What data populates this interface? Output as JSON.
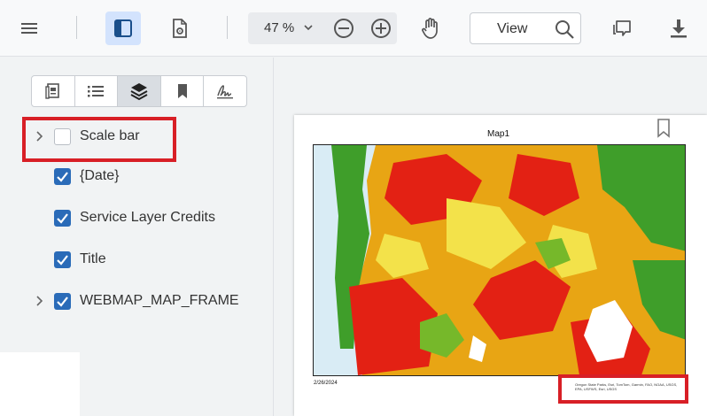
{
  "toolbar": {
    "zoom_value": "47 %",
    "view_label": "View"
  },
  "sidebar": {
    "tabs": [
      {
        "name": "thumbnails"
      },
      {
        "name": "outline"
      },
      {
        "name": "layers",
        "active": true
      },
      {
        "name": "bookmarks"
      },
      {
        "name": "signatures"
      }
    ],
    "layers": [
      {
        "label": "Scale bar",
        "checked": false,
        "expandable": true
      },
      {
        "label": "{Date}",
        "checked": true,
        "expandable": false
      },
      {
        "label": "Service Layer Credits",
        "checked": true,
        "expandable": false
      },
      {
        "label": "Title",
        "checked": true,
        "expandable": false
      },
      {
        "label": "WEBMAP_MAP_FRAME",
        "checked": true,
        "expandable": true
      }
    ]
  },
  "document": {
    "map_title": "Map1",
    "date": "2/26/2024",
    "credits": "Oregon State Parks, Esri, TomTom, Garmin, FAO, NOAA, USGS, EPA, USFWS, Esri, USGS"
  },
  "colors": {
    "accent": "#2a6bb8",
    "highlight": "#d81f26",
    "active_toggle": "#d3e3fd"
  }
}
